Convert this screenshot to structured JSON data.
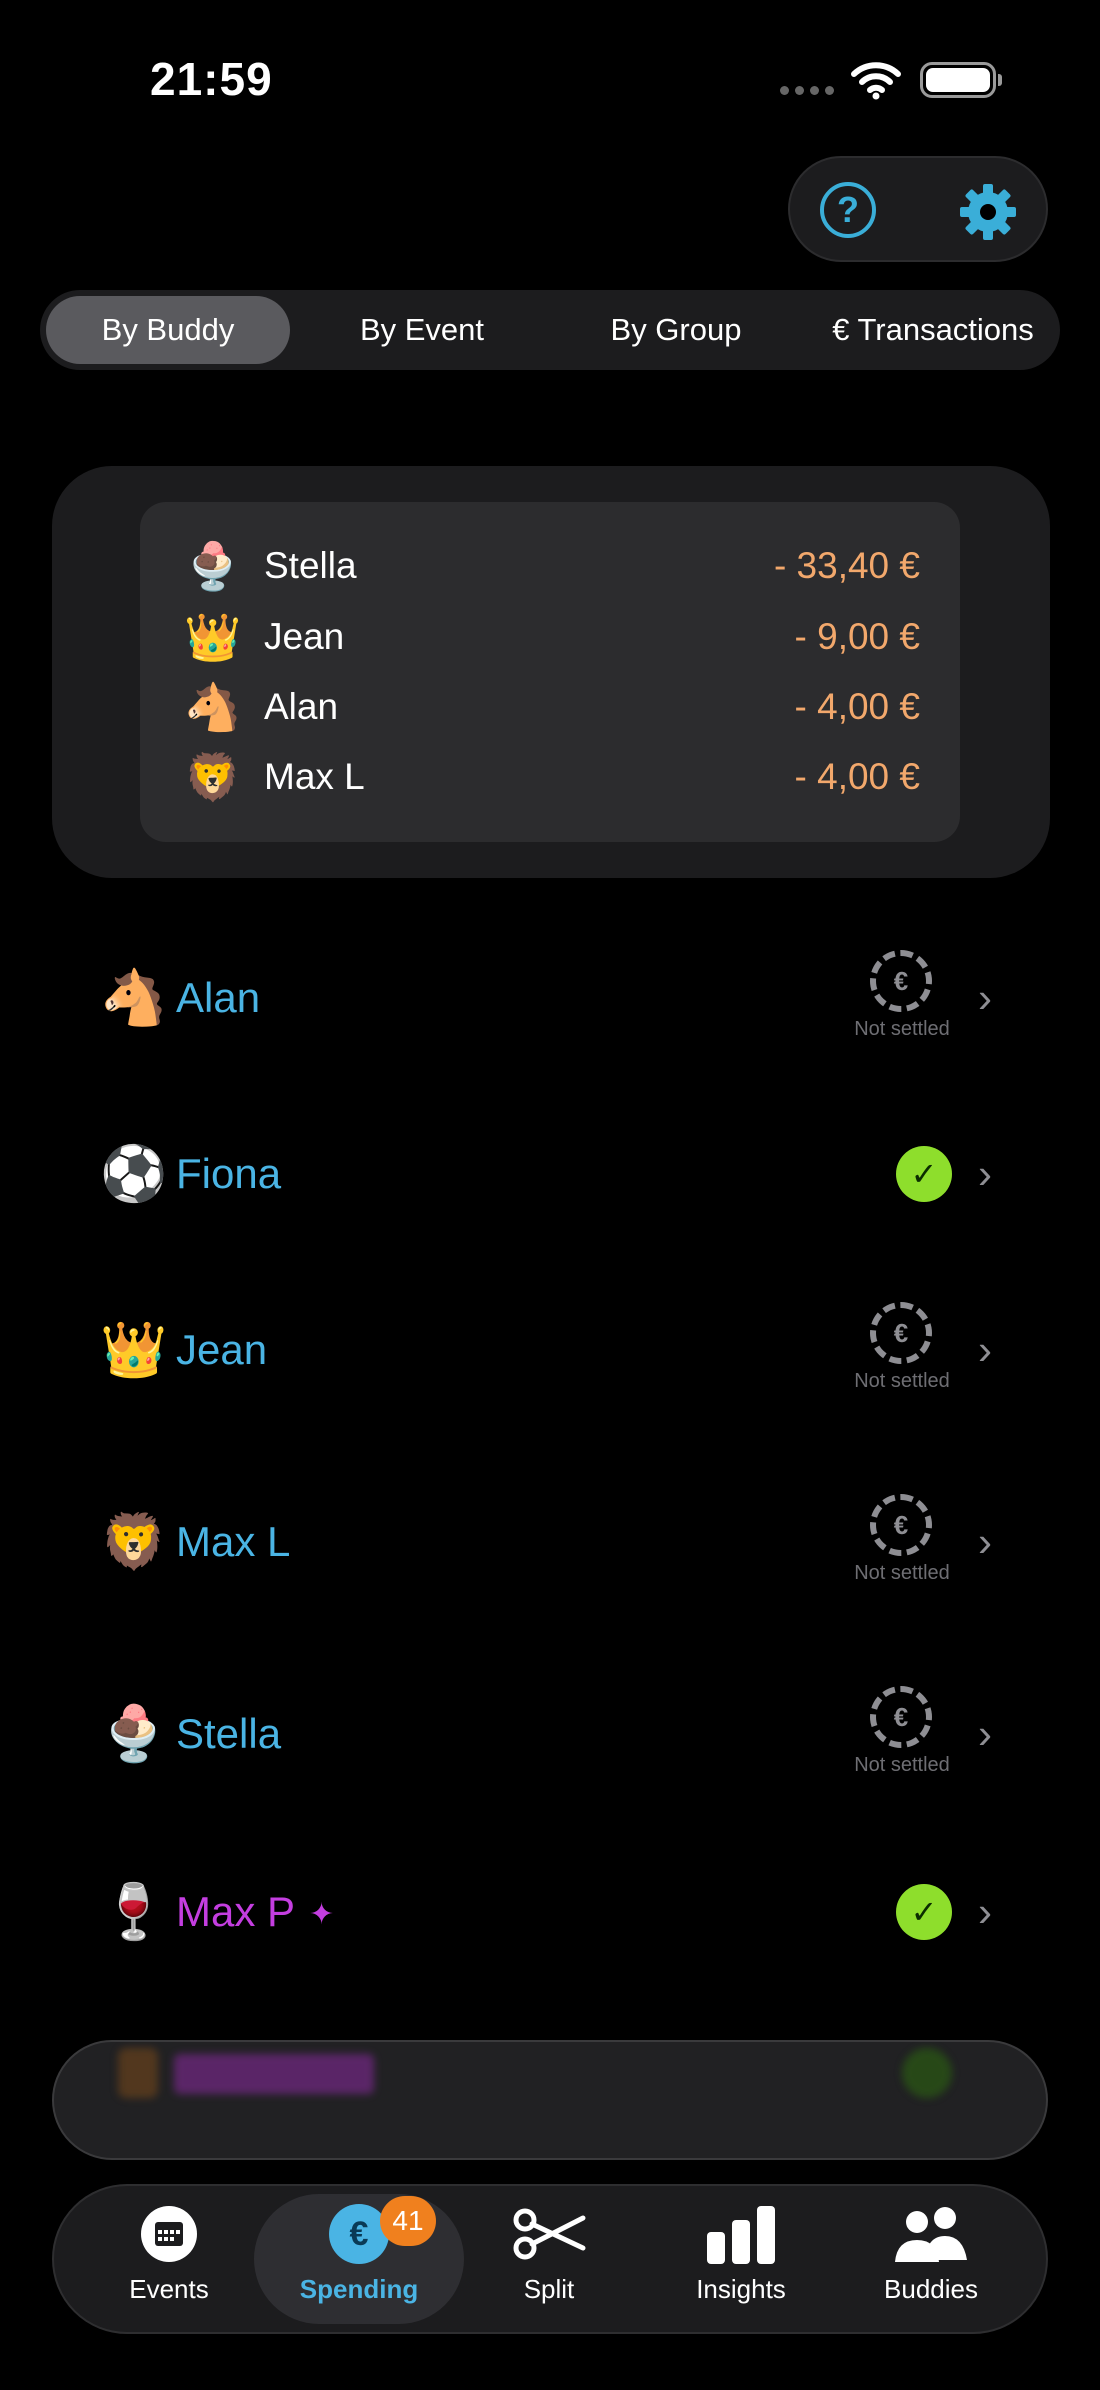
{
  "status_bar": {
    "time": "21:59"
  },
  "tabs_segment": [
    {
      "label": "By Buddy",
      "active": true
    },
    {
      "label": "By Event",
      "active": false
    },
    {
      "label": "By Group",
      "active": false
    },
    {
      "label": "€ Transactions",
      "active": false
    }
  ],
  "summary": [
    {
      "emoji": "🍨",
      "name": "Stella",
      "amount": "- 33,40 €"
    },
    {
      "emoji": "👑",
      "name": "Jean",
      "amount": "- 9,00 €"
    },
    {
      "emoji": "🐴",
      "name": "Alan",
      "amount": "- 4,00 €"
    },
    {
      "emoji": "🦁",
      "name": "Max L",
      "amount": "- 4,00 €"
    }
  ],
  "buddies": [
    {
      "emoji": "🐴",
      "name": "Alan",
      "status": "Not settled",
      "settled": false
    },
    {
      "emoji": "⚽",
      "name": "Fiona",
      "status": "",
      "settled": true
    },
    {
      "emoji": "👑",
      "name": "Jean",
      "status": "Not settled",
      "settled": false
    },
    {
      "emoji": "🦁",
      "name": "Max L",
      "status": "Not settled",
      "settled": false
    },
    {
      "emoji": "🍨",
      "name": "Stella",
      "status": "Not settled",
      "settled": false
    },
    {
      "emoji": "🍷",
      "name": "Max P",
      "status": "",
      "settled": true
    }
  ],
  "tab_bar": {
    "items": [
      {
        "label": "Events",
        "icon": "calendar-icon"
      },
      {
        "label": "Spending",
        "icon": "euro-icon",
        "active": true,
        "badge": "41"
      },
      {
        "label": "Split",
        "icon": "scissors-icon"
      },
      {
        "label": "Insights",
        "icon": "bar-chart-icon"
      },
      {
        "label": "Buddies",
        "icon": "people-icon"
      }
    ]
  },
  "colors": {
    "accent": "#4ab4e4",
    "amount": "#f2a86c",
    "settled": "#8ede2c",
    "purple": "#c43ee0",
    "badge": "#f0801e"
  }
}
